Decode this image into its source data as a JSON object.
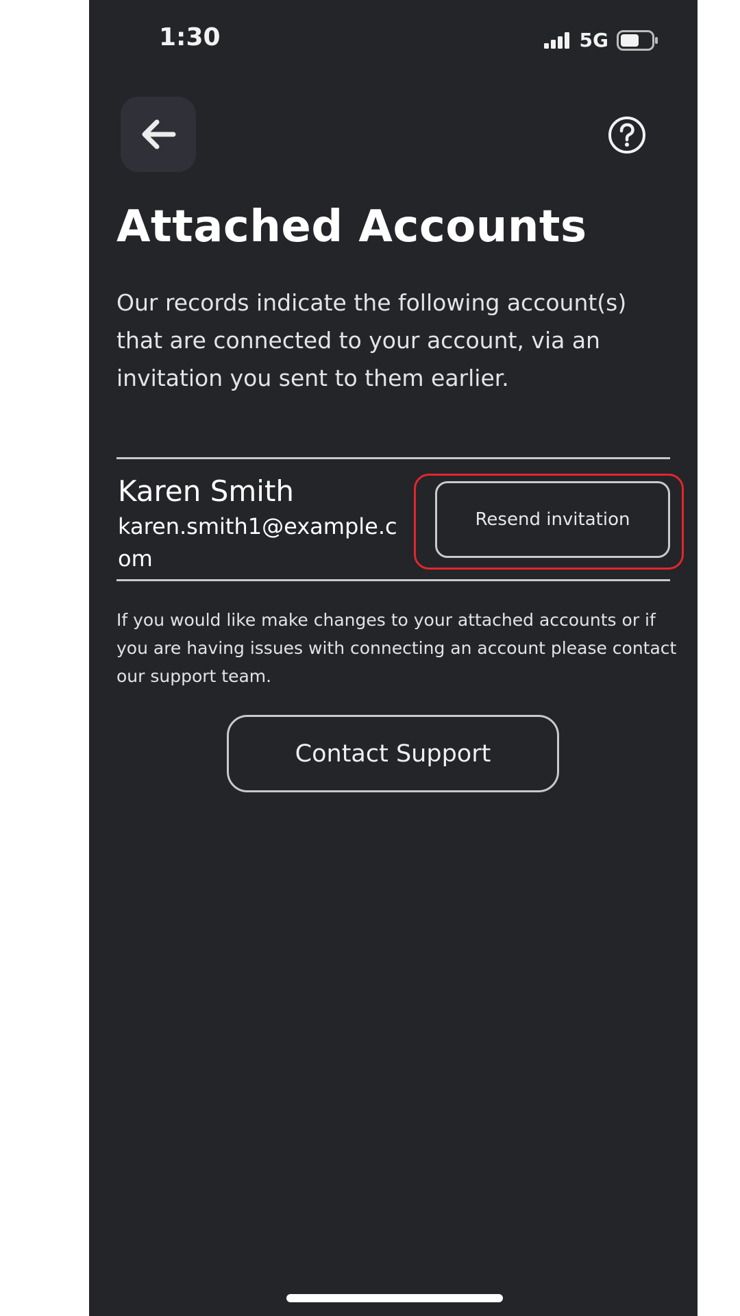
{
  "status_bar": {
    "time": "1:30",
    "network": "5G"
  },
  "header": {
    "back_icon": "arrow-left-icon",
    "help_icon": "question-circle-icon"
  },
  "page": {
    "title": "Attached Accounts",
    "intro": "Our records indicate the following account(s) that are connected to your account, via an invitation you sent to them earlier."
  },
  "account": {
    "name": "Karen Smith",
    "email": "karen.smith1@example.com",
    "resend_label": "Resend invitation"
  },
  "support": {
    "note": "If you would like make changes to your attached accounts or if you are having issues with connecting an account please contact our support team.",
    "button_label": "Contact Support"
  },
  "colors": {
    "background": "#242529",
    "highlight": "#e3262b",
    "border": "#c9cacd"
  }
}
